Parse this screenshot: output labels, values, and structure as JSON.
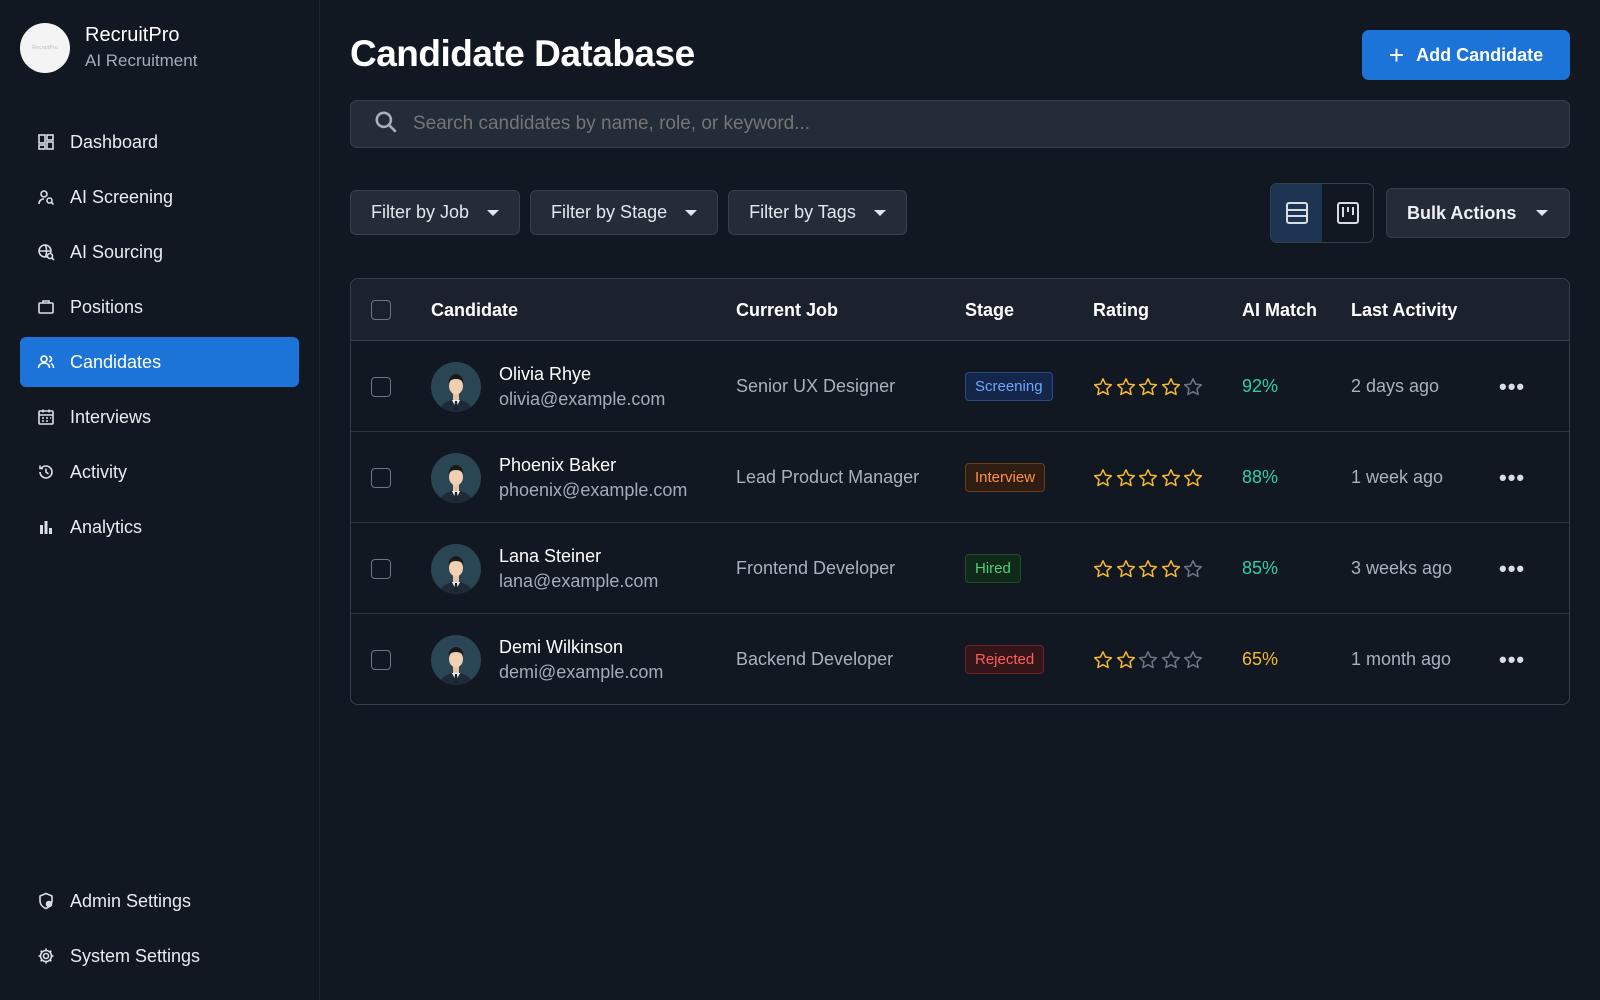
{
  "brand": {
    "name": "RecruitPro",
    "subtitle": "AI Recruitment",
    "logo_text": "RecruitPro"
  },
  "sidebar": {
    "items": [
      {
        "label": "Dashboard",
        "icon": "dashboard-icon",
        "active": false
      },
      {
        "label": "AI Screening",
        "icon": "ai-screening-icon",
        "active": false
      },
      {
        "label": "AI Sourcing",
        "icon": "ai-sourcing-icon",
        "active": false
      },
      {
        "label": "Positions",
        "icon": "briefcase-icon",
        "active": false
      },
      {
        "label": "Candidates",
        "icon": "users-icon",
        "active": true
      },
      {
        "label": "Interviews",
        "icon": "calendar-icon",
        "active": false
      },
      {
        "label": "Activity",
        "icon": "history-icon",
        "active": false
      },
      {
        "label": "Analytics",
        "icon": "bar-chart-icon",
        "active": false
      }
    ],
    "bottom_items": [
      {
        "label": "Admin Settings",
        "icon": "admin-shield-icon"
      },
      {
        "label": "System Settings",
        "icon": "gear-icon"
      }
    ]
  },
  "header": {
    "title": "Candidate Database",
    "add_label": "Add Candidate"
  },
  "search": {
    "placeholder": "Search candidates by name, role, or keyword..."
  },
  "filters": [
    {
      "label": "Filter by Job"
    },
    {
      "label": "Filter by Stage"
    },
    {
      "label": "Filter by Tags"
    }
  ],
  "view_toggle": {
    "active": "list"
  },
  "bulk_actions_label": "Bulk Actions",
  "table": {
    "columns": [
      "Candidate",
      "Current Job",
      "Stage",
      "Rating",
      "AI Match",
      "Last Activity"
    ],
    "rows": [
      {
        "name": "Olivia Rhye",
        "email": "olivia@example.com",
        "job": "Senior UX Designer",
        "stage": "Screening",
        "stage_key": "screening",
        "rating": 4,
        "match": "92%",
        "match_color": "#2fcfa4",
        "activity": "2 days ago"
      },
      {
        "name": "Phoenix Baker",
        "email": "phoenix@example.com",
        "job": "Lead Product Manager",
        "stage": "Interview",
        "stage_key": "interview",
        "rating": 5,
        "match": "88%",
        "match_color": "#2fcfa4",
        "activity": "1 week ago"
      },
      {
        "name": "Lana Steiner",
        "email": "lana@example.com",
        "job": "Frontend Developer",
        "stage": "Hired",
        "stage_key": "hired",
        "rating": 4,
        "match": "85%",
        "match_color": "#2fcfa4",
        "activity": "3 weeks ago"
      },
      {
        "name": "Demi Wilkinson",
        "email": "demi@example.com",
        "job": "Backend Developer",
        "stage": "Rejected",
        "stage_key": "rejected",
        "rating": 2,
        "match": "65%",
        "match_color": "#f5b82e",
        "activity": "1 month ago"
      }
    ]
  },
  "colors": {
    "accent": "#1d74d8",
    "star_filled": "#f5b82e",
    "star_empty": "#6b7686"
  }
}
